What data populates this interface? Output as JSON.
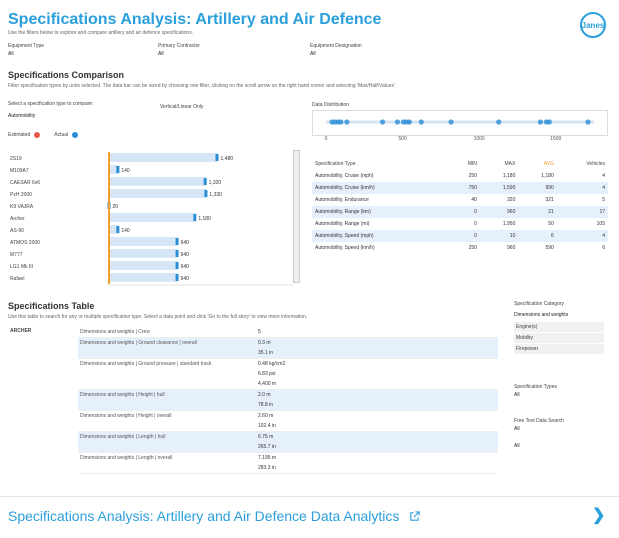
{
  "header": {
    "title": "Specifications Analysis: Artillery and Air Defence",
    "subtitle": "Use the filters below to explore and compare artillery and air defence specifications.",
    "logo_text": "Janes"
  },
  "filters": [
    {
      "label": "Equipment Type",
      "value": "All"
    },
    {
      "label": "Primary Contractor",
      "value": "All"
    },
    {
      "label": "Equipment Designation",
      "value": "All"
    }
  ],
  "comparison": {
    "heading": "Specifications Comparison",
    "description": "Filter specification types by units selected. The data bar can be sized by choosing one filter, clicking on the scroll arrow on the right hand corner and selecting 'Max/Half/Values'",
    "select_label": "Select a specification type to compare:",
    "select_value": "Automobility",
    "toggle_label": "Vertical/Linear Only",
    "legend": [
      {
        "name": "Estimated",
        "color": "#e8584a"
      },
      {
        "name": "Actual",
        "color": "#2b8fd6"
      }
    ]
  },
  "chart_data": {
    "type": "bar",
    "categories": [
      "2S19",
      "M109A7",
      "CAESAR 6x6",
      "PzH 2000",
      "K9 VAJRA",
      "Archer",
      "AS-90",
      "ATMOS 2000",
      "M777",
      "LG1 Mk III",
      "Rafael"
    ],
    "values": [
      1480,
      140,
      1320,
      1330,
      20,
      1180,
      140,
      940,
      940,
      940,
      940
    ],
    "accent_x": 0,
    "xticks": [
      "0",
      "500",
      "1000",
      "1500",
      "2000",
      "2500"
    ],
    "xlim": [
      0,
      2500
    ],
    "bar_color": "#d7e6f6",
    "marker_color": "#2b8fd6",
    "baseline_color": "#f0a030"
  },
  "distribution": {
    "label": "Data Distribution",
    "ticks": [
      "0",
      "500",
      "1000",
      "1500"
    ],
    "points": [
      10,
      15,
      20,
      25,
      35,
      95,
      120,
      130,
      135,
      140,
      160,
      210,
      290,
      360,
      370,
      375,
      440
    ]
  },
  "spec_table": {
    "columns": [
      "Specification Type",
      "MIN",
      "MAX",
      "AVG",
      "Vehicles"
    ],
    "rows": [
      [
        "Automobility, Cruise (mph)",
        "250",
        "1,180",
        "1,180",
        "4"
      ],
      [
        "Automobility, Cruise (km/h)",
        "750",
        "1,590",
        "990",
        "4"
      ],
      [
        "Automobility, Endurance",
        "40",
        "320",
        "321",
        "5"
      ],
      [
        "Automobility, Range (km)",
        "0",
        "960",
        "21",
        "17"
      ],
      [
        "Automobility, Range (mi)",
        "0",
        "1,950",
        "50",
        "105"
      ],
      [
        "Automobility, Speed (mph)",
        "0",
        "10",
        "6",
        "4"
      ],
      [
        "Automobility, Speed (km/h)",
        "250",
        "960",
        "590",
        "6"
      ]
    ]
  },
  "specs_table": {
    "heading": "Specifications Table",
    "description": "Use this table to search for any or multiple specification type. Select a data point and click 'Go to the full story' to view more information.",
    "entity": "ARCHER",
    "rows": [
      {
        "label": "Dimensions and weights | Crew",
        "values": [
          "5"
        ]
      },
      {
        "label": "Dimensions and weights | Ground clearance | overall",
        "values": [
          "0.3 m",
          "35.1 in"
        ]
      },
      {
        "label": "Dimensions and weights | Ground pressure | standard track",
        "values": [
          "0.48 kg/cm2",
          "6.83 psi",
          "4,400 m"
        ]
      },
      {
        "label": "Dimensions and weights | Height | hull",
        "values": [
          "2.0 m",
          "78.8 in"
        ]
      },
      {
        "label": "Dimensions and weights | Height | overall",
        "values": [
          "2.60 m",
          "102.4 in"
        ]
      },
      {
        "label": "Dimensions and weights | Length | hull",
        "values": [
          "6.75 m",
          "265.7 in"
        ]
      },
      {
        "label": "Dimensions and weights | Length | overall",
        "values": [
          "7.195 m",
          "283.3 in"
        ]
      }
    ]
  },
  "sidebar": {
    "category_label": "Specification Category",
    "category_value": "Dimensions and weights",
    "options": [
      "Engine(s)",
      "Mobility",
      "Firepower"
    ],
    "type_label": "Specification Types",
    "type_value": "All",
    "search_label": "Free Text Data Search",
    "search_value": "All",
    "extra_value": "All"
  },
  "footer": {
    "text": "Specifications Analysis: Artillery and Air Defence Data Analytics",
    "link_icon": "external-link-icon",
    "nav_icon": "chevron-right-icon"
  }
}
